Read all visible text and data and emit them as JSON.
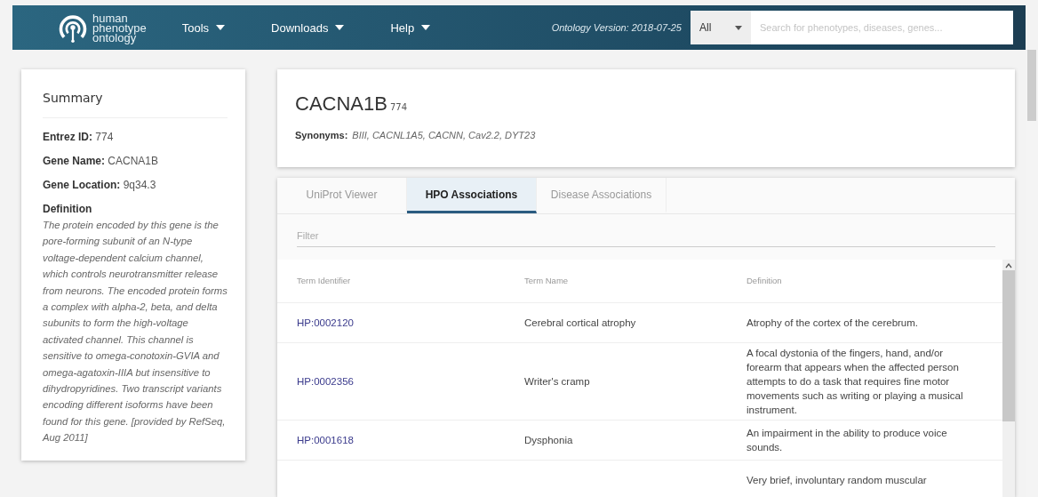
{
  "navbar": {
    "logo": {
      "lines": [
        "human",
        "phenotype",
        "ontology"
      ]
    },
    "menus": [
      {
        "label": "Tools"
      },
      {
        "label": "Downloads"
      },
      {
        "label": "Help"
      }
    ],
    "version": "Ontology Version: 2018-07-25",
    "search": {
      "category": "All",
      "placeholder": "Search for phenotypes, diseases, genes..."
    }
  },
  "summary": {
    "title": "Summary",
    "fields": [
      {
        "label": "Entrez ID:",
        "value": "774"
      },
      {
        "label": "Gene Name:",
        "value": "CACNA1B"
      },
      {
        "label": "Gene Location:",
        "value": "9q34.3"
      }
    ],
    "definition_label": "Definition",
    "definition": "The protein encoded by this gene is the pore-forming subunit of an N-type voltage-dependent calcium channel, which controls neurotransmitter release from neurons. The encoded protein forms a complex with alpha-2, beta, and delta subunits to form the high-voltage activated channel. This channel is sensitive to omega-conotoxin-GVIA and omega-agatoxin-IIIA but insensitive to dihydropyridines. Two transcript variants encoding different isoforms have been found for this gene. [provided by RefSeq, Aug 2011]"
  },
  "gene": {
    "symbol": "CACNA1B",
    "id": "774",
    "synonyms_label": "Synonyms:",
    "synonyms": "BIII, CACNL1A5, CACNN, Cav2.2, DYT23"
  },
  "tabs": [
    {
      "label": "UniProt Viewer",
      "selected": false
    },
    {
      "label": "HPO Associations",
      "selected": true
    },
    {
      "label": "Disease Associations",
      "selected": false
    }
  ],
  "filter": {
    "placeholder": "Filter"
  },
  "table": {
    "columns": [
      "Term Identifier",
      "Term Name",
      "Definition"
    ],
    "rows": [
      {
        "id": "HP:0002120",
        "name": "Cerebral cortical atrophy",
        "definition": "Atrophy of the cortex of the cerebrum."
      },
      {
        "id": "HP:0002356",
        "name": "Writer's cramp",
        "definition": "A focal dystonia of the fingers, hand, and/or forearm that appears when the affected person attempts to do a task that requires fine motor movements such as writing or playing a musical instrument."
      },
      {
        "id": "HP:0001618",
        "name": "Dysphonia",
        "definition": "An impairment in the ability to produce voice sounds."
      },
      {
        "definition": "Very brief, involuntary random muscular"
      }
    ]
  }
}
